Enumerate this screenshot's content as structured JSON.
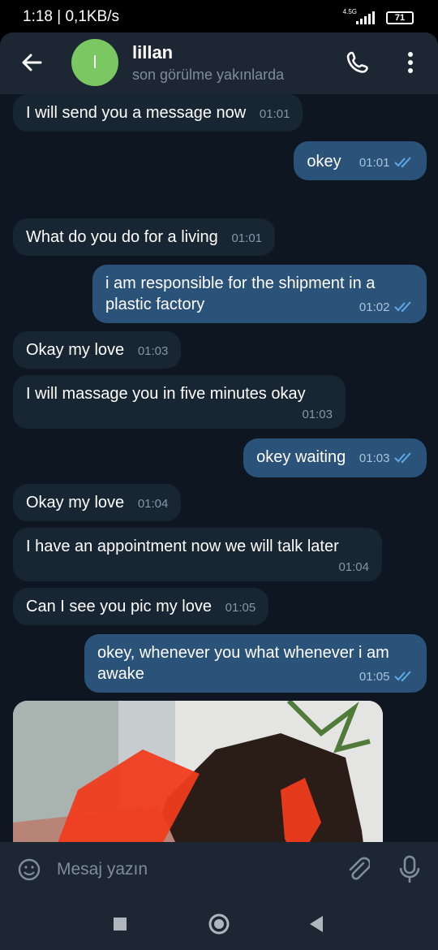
{
  "status_bar": {
    "time": "1:18 | 0,1KB/s",
    "network": "4.5G",
    "battery": "71"
  },
  "header": {
    "avatar_letter": "l",
    "name": "lillan",
    "last_seen": "son görülme yakınlarda"
  },
  "messages": [
    {
      "dir": "in",
      "text": "I will send you a message now",
      "time": "01:01"
    },
    {
      "dir": "out",
      "text": "okey",
      "time": "01:01"
    },
    {
      "dir": "in",
      "text": "What do you do for a living",
      "time": "01:01"
    },
    {
      "dir": "out",
      "text": "i am responsible for the shipment in a plastic factory",
      "time": "01:02"
    },
    {
      "dir": "in",
      "text": "Okay my love",
      "time": "01:03"
    },
    {
      "dir": "in",
      "text": "I will massage you in five minutes okay",
      "time": "01:03"
    },
    {
      "dir": "out",
      "text": "okey waiting",
      "time": "01:03"
    },
    {
      "dir": "in",
      "text": "Okay my love",
      "time": "01:04"
    },
    {
      "dir": "in",
      "text": "I have an appointment now we will talk later",
      "time": "01:04"
    },
    {
      "dir": "in",
      "text": "Can I see you pic my love",
      "time": "01:05"
    },
    {
      "dir": "out",
      "text": "okey, whenever you what whenever i am awake",
      "time": "01:05"
    }
  ],
  "input": {
    "placeholder": "Mesaj yazın"
  },
  "colors": {
    "bg": "#0e1621",
    "header": "#1c2733",
    "bubble_in": "#182533",
    "bubble_out": "#2b5278",
    "check": "#5ea9e8",
    "avatar": "#7bc862"
  }
}
